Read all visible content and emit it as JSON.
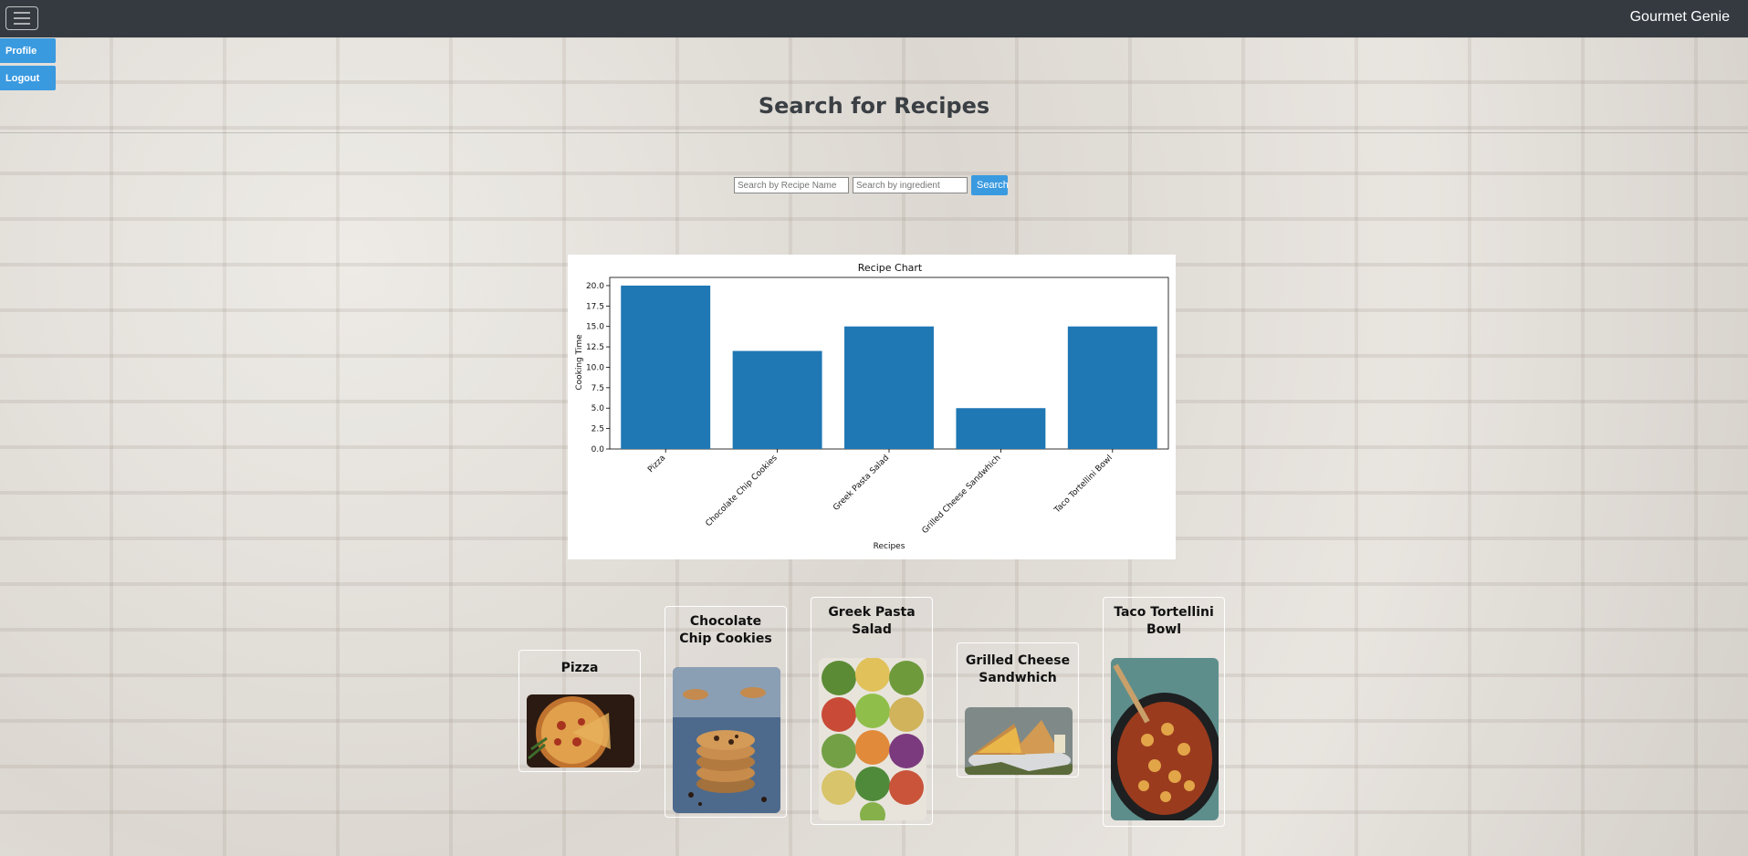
{
  "navbar": {
    "menu_icon": "hamburger-menu-icon",
    "brand": "Gourmet Genie"
  },
  "sidebar": {
    "profile_label": "Profile",
    "logout_label": "Logout",
    "accent_color": "#3a9ae0"
  },
  "page": {
    "title": "Search for Recipes"
  },
  "search": {
    "recipe_name_placeholder": "Search by Recipe Name",
    "ingredient_placeholder": "Search by ingredient",
    "button_label": "Search"
  },
  "chart_data": {
    "type": "bar",
    "title": "Recipe Chart",
    "xlabel": "Recipes",
    "ylabel": "Cooking Time",
    "categories": [
      "Pizza",
      "Chocolate Chip Cookies",
      "Greek Pasta Salad",
      "Grilled Cheese Sandwhich",
      "Taco Tortellini Bowl"
    ],
    "values": [
      20,
      12,
      15,
      5,
      15
    ],
    "ylim": [
      0,
      21
    ],
    "yticks": [
      "0.0",
      "2.5",
      "5.0",
      "7.5",
      "10.0",
      "12.5",
      "15.0",
      "17.5",
      "20.0"
    ],
    "bar_color": "#1f77b4",
    "grid": false
  },
  "recipes": [
    {
      "title": "Pizza"
    },
    {
      "title": "Chocolate Chip Cookies"
    },
    {
      "title": "Greek Pasta Salad"
    },
    {
      "title": "Grilled Cheese Sandwhich"
    },
    {
      "title": "Taco Tortellini Bowl"
    }
  ]
}
